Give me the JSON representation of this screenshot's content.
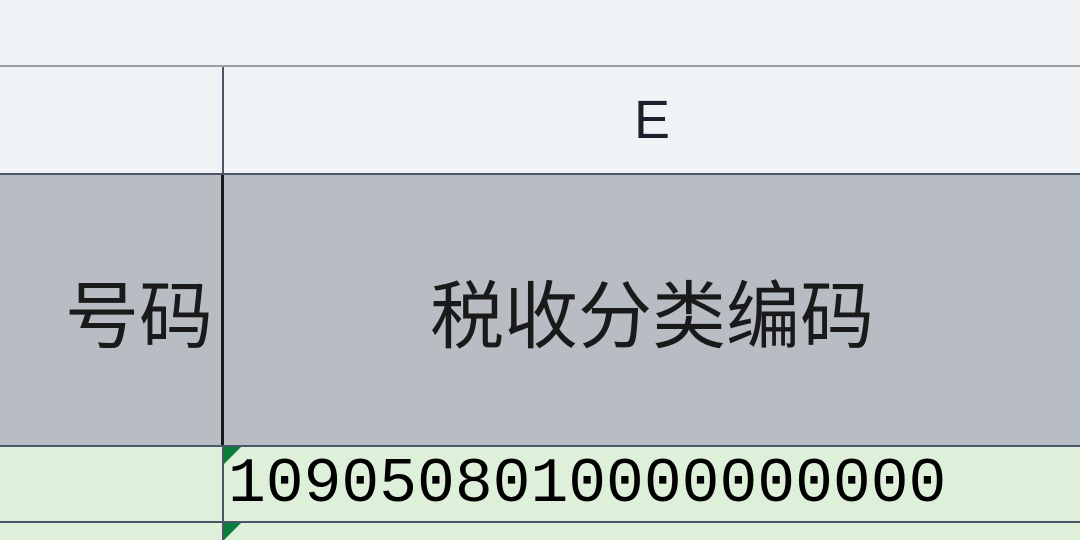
{
  "columns": {
    "d_letter": "",
    "e_letter": "E"
  },
  "headers": {
    "col_d": "号码",
    "col_e": "税收分类编码"
  },
  "cells": {
    "e2": "1090508010000000000"
  }
}
